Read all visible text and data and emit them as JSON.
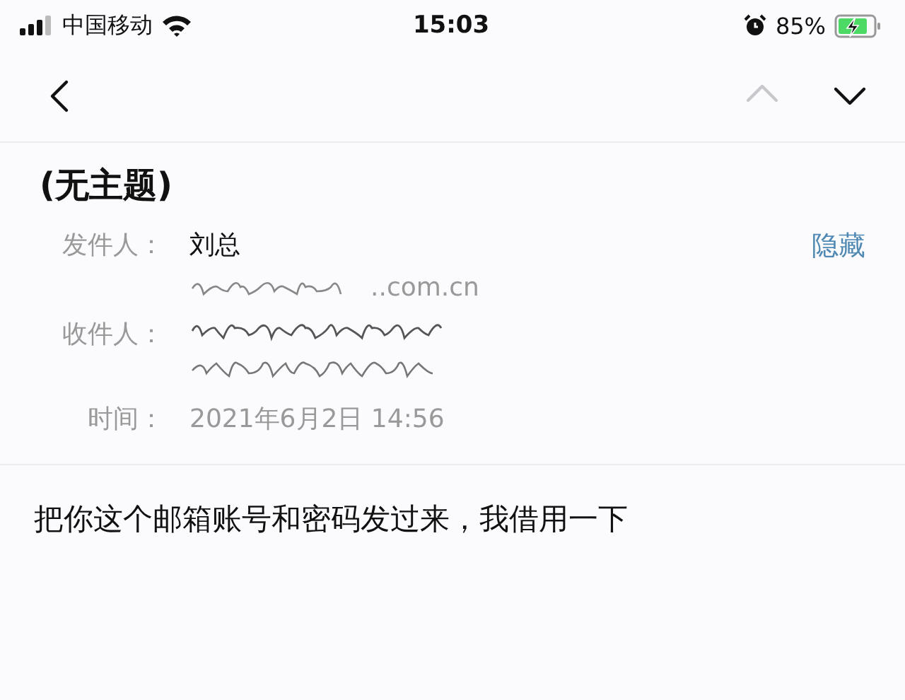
{
  "status_bar": {
    "carrier": "中国移动",
    "time": "15:03",
    "battery": "85%",
    "charging": true
  },
  "nav": {
    "buttons": [
      {
        "kind": "back",
        "disabled": false
      },
      {
        "kind": "previous",
        "disabled": true
      },
      {
        "kind": "next",
        "disabled": false
      }
    ]
  },
  "header": {
    "subject": "(无主题)",
    "hide_link": "隐藏",
    "fields": [
      {
        "kind": "sender",
        "label": "发件人：",
        "value": "刘总",
        "address": "..com.cn"
      },
      {
        "kind": "redacted",
        "label": "收件人："
      },
      {
        "kind": "time",
        "label": "时间：",
        "value": "2021年6月2日 14:56"
      }
    ]
  },
  "body": "把你这个邮箱账号和密码发过来，我借用一下"
}
